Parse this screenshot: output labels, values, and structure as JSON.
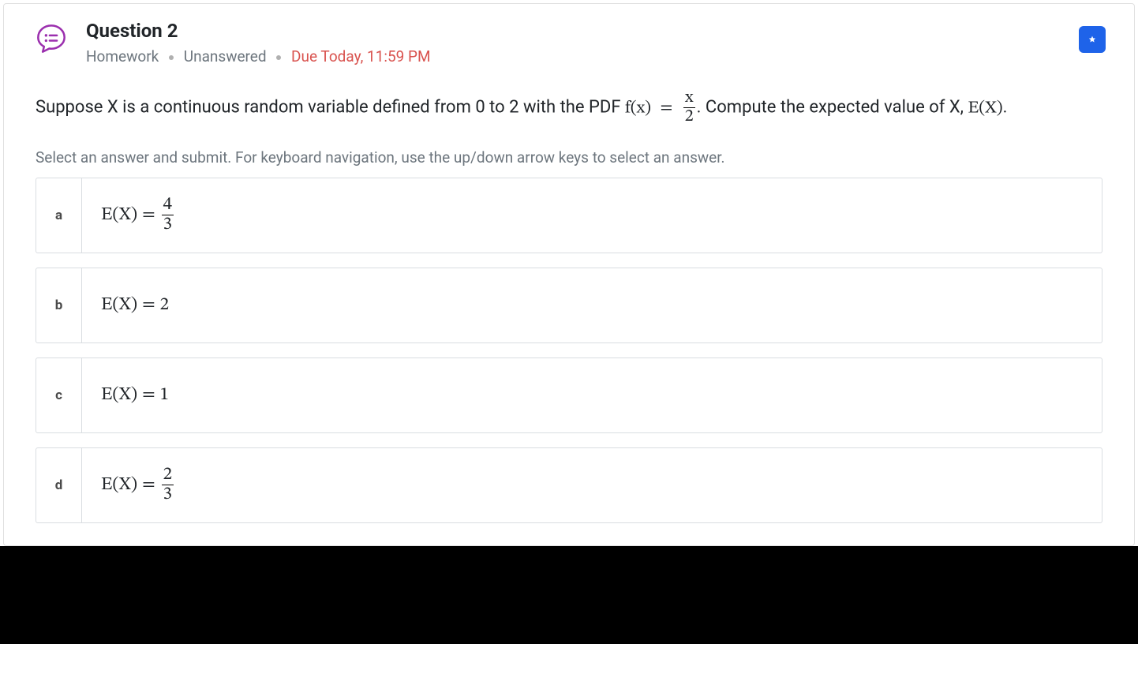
{
  "header": {
    "title": "Question 2",
    "category": "Homework",
    "status": "Unanswered",
    "due": "Due Today, 11:59 PM"
  },
  "prompt": {
    "part1": "Suppose X is a continuous random variable defined from 0 to 2 with the PDF ",
    "func": "f(x)",
    "eq": "=",
    "frac_num": "x",
    "frac_den": "2",
    "period": ".",
    "part2": " Compute the expected value of X, ",
    "expr": "E(X)",
    "trail": "."
  },
  "instructions": "Select an answer and submit. For keyboard navigation, use the up/down arrow keys to select an answer.",
  "options": [
    {
      "letter": "a",
      "lhs": "E(X)",
      "eq": "=",
      "type": "frac",
      "num": "4",
      "den": "3"
    },
    {
      "letter": "b",
      "lhs": "E(X)",
      "eq": "=",
      "type": "val",
      "val": "2"
    },
    {
      "letter": "c",
      "lhs": "E(X)",
      "eq": "=",
      "type": "val",
      "val": "1"
    },
    {
      "letter": "d",
      "lhs": "E(X)",
      "eq": "=",
      "type": "frac",
      "num": "2",
      "den": "3"
    }
  ]
}
